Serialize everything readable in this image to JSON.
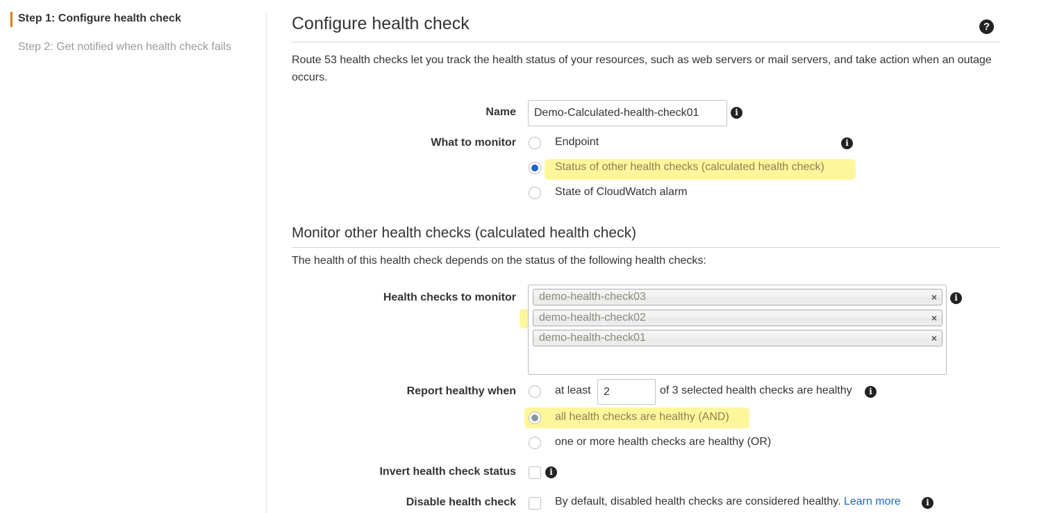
{
  "nav": {
    "step1": "Step 1: Configure health check",
    "step2": "Step 2: Get notified when health check fails"
  },
  "page": {
    "title": "Configure health check",
    "intro": "Route 53 health checks let you track the health status of your resources, such as web servers or mail servers, and take action when an outage occurs."
  },
  "form": {
    "name_label": "Name",
    "name_value": "Demo-Calculated-health-check01",
    "monitor_label": "What to monitor",
    "monitor_options": [
      {
        "label": "Endpoint",
        "selected": false
      },
      {
        "label": "Status of other health checks (calculated health check)",
        "selected": true
      },
      {
        "label": "State of CloudWatch alarm",
        "selected": false
      }
    ]
  },
  "calculated": {
    "title": "Monitor other health checks (calculated health check)",
    "intro": "The health of this health check depends on the status of the following health checks:",
    "checks_label": "Health checks to monitor",
    "selected_checks": [
      "demo-health-check03",
      "demo-health-check02",
      "demo-health-check01"
    ],
    "remove_glyph": "×",
    "report_label": "Report healthy when",
    "at_least_prefix": "at least",
    "at_least_value": "2",
    "at_least_suffix": "of 3 selected health checks are healthy",
    "and_option": "all health checks are healthy (AND)",
    "or_option": "one or more health checks are healthy (OR)",
    "invert_label": "Invert health check status",
    "disable_label": "Disable health check",
    "disable_note": "By default, disabled health checks are considered healthy.",
    "learn_more": "Learn more"
  },
  "icons": {
    "help": "?",
    "info": "i"
  },
  "colors": {
    "accent": "#e07b16",
    "radio_selected": "#1a66c9",
    "highlight": "#fff37a",
    "link": "#1d67c4"
  }
}
